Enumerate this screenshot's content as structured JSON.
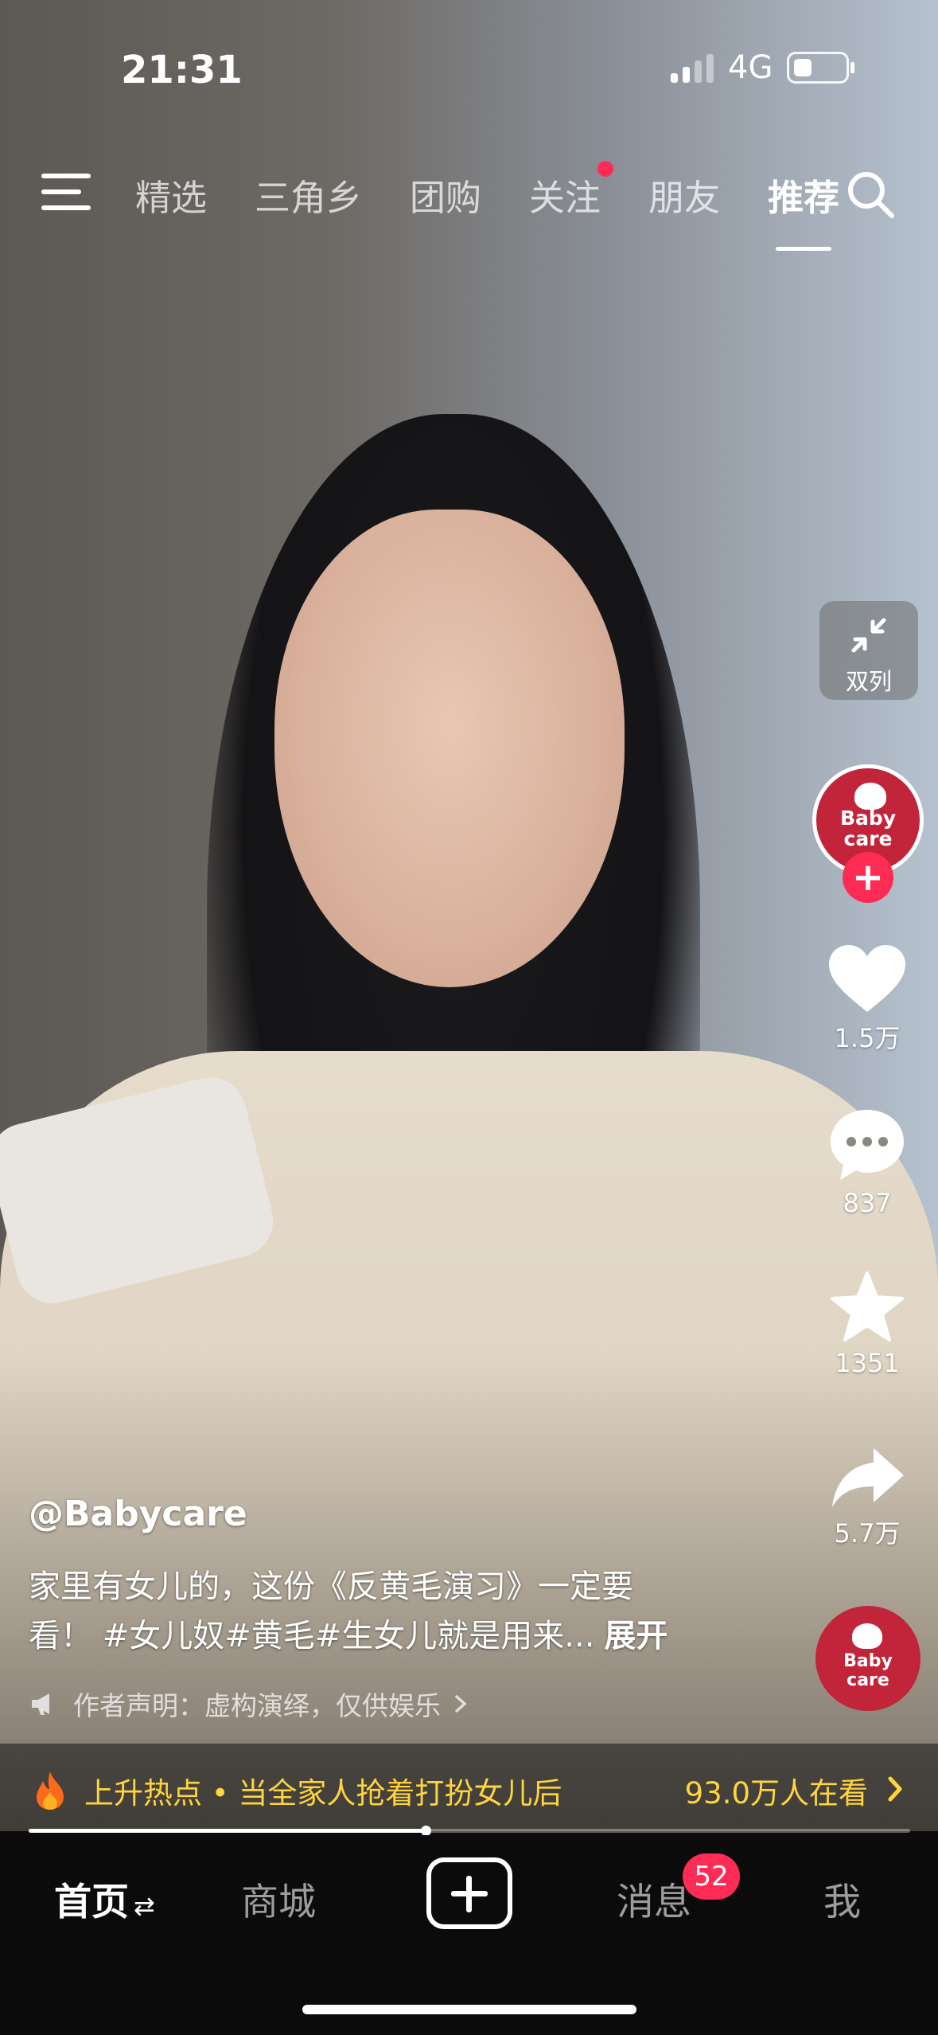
{
  "status_bar": {
    "time": "21:31",
    "network": "4G"
  },
  "top_nav": {
    "tabs": [
      {
        "label": "精选"
      },
      {
        "label": "三角乡"
      },
      {
        "label": "团购"
      },
      {
        "label": "关注",
        "has_dot": true
      },
      {
        "label": "朋友"
      },
      {
        "label": "推荐",
        "active": true
      }
    ]
  },
  "right_rail": {
    "dual_column_label": "双列",
    "avatar_logo_line1": "Baby",
    "avatar_logo_line2": "care",
    "likes": "1.5万",
    "comments": "837",
    "favorites": "1351",
    "shares": "5.7万"
  },
  "video": {
    "author": "@Babycare",
    "caption_line1": "家里有女儿的，这份《反黄毛演习》一定要",
    "caption_line2": "看！ #女儿奴#黄毛#生女儿就是用来...",
    "expand_label": "展开",
    "declaration": "作者声明：虚构演绎，仅供娱乐",
    "progress": 0.45
  },
  "hot_bar": {
    "text": "上升热点 • 当全家人抢着打扮女儿后",
    "viewers": "93.0万人在看"
  },
  "bottom_nav": {
    "home": "首页",
    "mall": "商城",
    "messages": "消息",
    "messages_badge": "52",
    "me": "我"
  },
  "colors": {
    "accent_red": "#fe2c55",
    "hot_yellow": "#ffd43d",
    "brand_red": "#c2243a"
  }
}
